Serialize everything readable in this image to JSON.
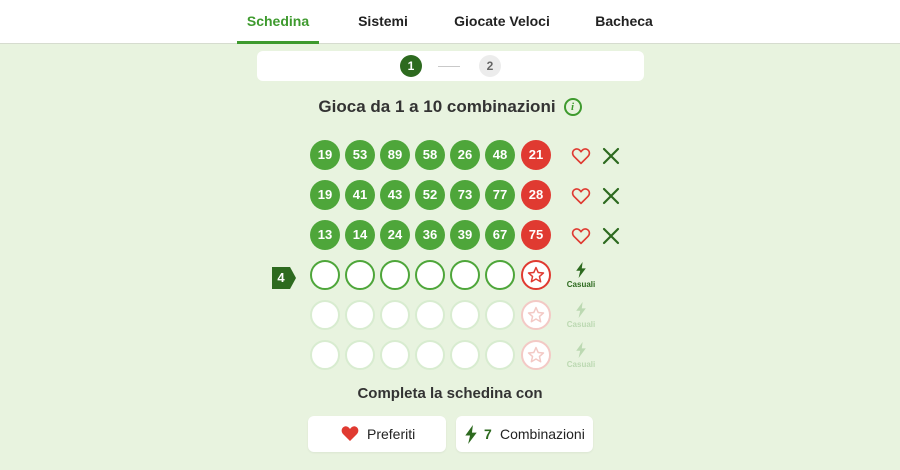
{
  "tabs": [
    {
      "label": "Schedina",
      "active": true
    },
    {
      "label": "Sistemi",
      "active": false
    },
    {
      "label": "Giocate Veloci",
      "active": false
    },
    {
      "label": "Bacheca",
      "active": false
    }
  ],
  "stepper": {
    "step1": "1",
    "step2": "2",
    "current": 1
  },
  "heading": "Gioca da 1 a 10 combinazioni",
  "combinations": [
    {
      "numbers": [
        "19",
        "53",
        "89",
        "58",
        "26",
        "48"
      ],
      "superstar": "21"
    },
    {
      "numbers": [
        "19",
        "41",
        "43",
        "52",
        "73",
        "77"
      ],
      "superstar": "28"
    },
    {
      "numbers": [
        "13",
        "14",
        "24",
        "36",
        "39",
        "67"
      ],
      "superstar": "75"
    }
  ],
  "active_row": {
    "number": "4",
    "random_label": "Casuali"
  },
  "empty_rows": [
    {
      "random_label": "Casuali"
    },
    {
      "random_label": "Casuali"
    }
  ],
  "complete_title": "Completa la schedina con",
  "actions": {
    "favorites_label": "Preferiti",
    "combinations_count": "7",
    "combinations_label": "Combinazioni"
  },
  "colors": {
    "accent": "#3e9a2e",
    "ball_green": "#4ea63a",
    "ball_red": "#e03a31",
    "background": "#e8f3df"
  }
}
